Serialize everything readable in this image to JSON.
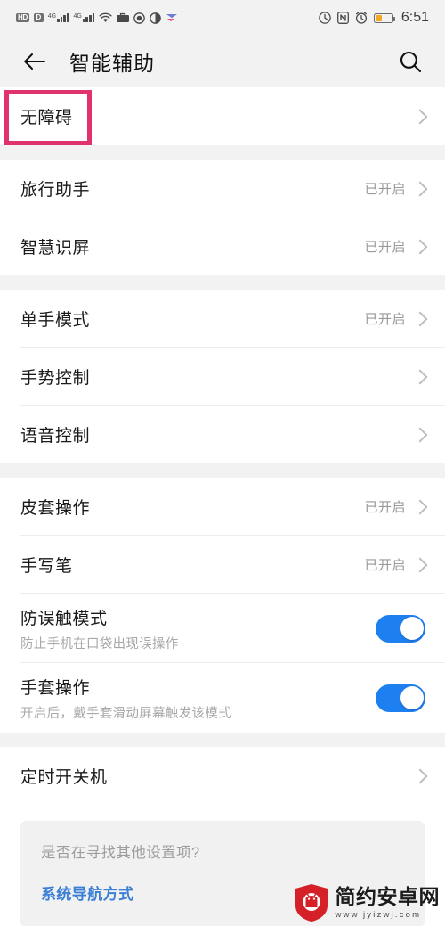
{
  "status_bar": {
    "hd_label": "HD",
    "volte_label": "D",
    "network_1": "4G",
    "network_2": "4G",
    "icons": [
      "hd-icon",
      "volte-icon",
      "signal-4g-icon",
      "signal-4g-icon",
      "wifi-icon",
      "briefcase-icon",
      "eye-protect-icon",
      "contrast-icon",
      "vpn-icon"
    ],
    "right_icons": [
      "data-saver-icon",
      "nfc-icon",
      "alarm-icon",
      "battery-icon"
    ],
    "battery_level_pct": 40,
    "time": "6:51"
  },
  "header": {
    "back_icon": "back-arrow-icon",
    "title": "智能辅助",
    "search_icon": "search-icon"
  },
  "sections": [
    {
      "rows": [
        {
          "title": "无障碍",
          "value": "",
          "type": "link",
          "highlighted": true
        }
      ]
    },
    {
      "rows": [
        {
          "title": "旅行助手",
          "value": "已开启",
          "type": "link"
        },
        {
          "title": "智慧识屏",
          "value": "已开启",
          "type": "link"
        }
      ]
    },
    {
      "rows": [
        {
          "title": "单手模式",
          "value": "已开启",
          "type": "link"
        },
        {
          "title": "手势控制",
          "value": "",
          "type": "link"
        },
        {
          "title": "语音控制",
          "value": "",
          "type": "link"
        }
      ]
    },
    {
      "rows": [
        {
          "title": "皮套操作",
          "value": "已开启",
          "type": "link"
        },
        {
          "title": "手写笔",
          "value": "已开启",
          "type": "link"
        },
        {
          "title": "防误触模式",
          "subtitle": "防止手机在口袋出现误操作",
          "type": "toggle",
          "toggle_on": true
        },
        {
          "title": "手套操作",
          "subtitle": "开启后，戴手套滑动屏幕触发该模式",
          "type": "toggle",
          "toggle_on": true
        }
      ]
    },
    {
      "rows": [
        {
          "title": "定时开关机",
          "value": "",
          "type": "link"
        }
      ]
    }
  ],
  "footer": {
    "question": "是否在寻找其他设置项?",
    "link": "系统导航方式"
  },
  "watermark": {
    "name": "简约安卓网",
    "url": "www.jyizwj.com"
  },
  "colors": {
    "highlight_border": "#e0336e",
    "toggle_on": "#1e7ff1",
    "link_blue": "#3a7fd5",
    "page_bg": "#f2f2f2",
    "battery_fill": "#f5a623"
  }
}
